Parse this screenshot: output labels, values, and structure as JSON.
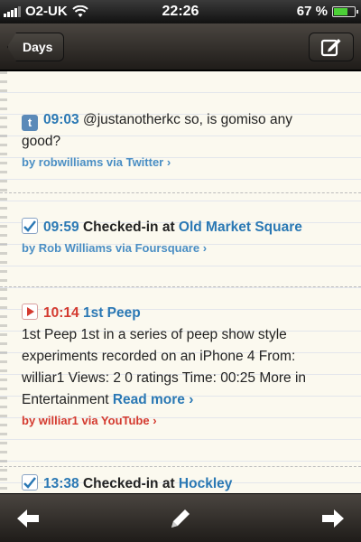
{
  "status_bar": {
    "carrier": "O2-UK",
    "time": "22:26",
    "battery_percent": "67 %",
    "battery_level": 0.67
  },
  "nav": {
    "back_label": "Days",
    "compose_icon": "compose-icon"
  },
  "entries": [
    {
      "service": "twitter",
      "time": "09:03",
      "line1": "@justanotherkc so, is gomiso any",
      "line2": "good?",
      "meta": "by robwilliams via Twitter ›"
    },
    {
      "service": "foursquare",
      "time": "09:59",
      "action": "Checked-in at",
      "place": "Old Market Square",
      "meta": "by Rob Williams via Foursquare ›"
    },
    {
      "service": "youtube",
      "time": "10:14",
      "title": "1st Peep",
      "body_lines": [
        "1st Peep 1st in a series of peep show style",
        "experiments recorded on an iPhone 4 From:",
        "williar1 Views: 2 0 ratings Time: 00:25 More in"
      ],
      "body_last": "Entertainment",
      "read_more": "Read more ›",
      "meta": "by williar1 via YouTube ›"
    },
    {
      "service": "foursquare",
      "time": "13:38",
      "action": "Checked-in at",
      "place": "Hockley"
    }
  ],
  "toolbar": {
    "prev_icon": "arrow-left-icon",
    "edit_icon": "pencil-icon",
    "next_icon": "arrow-right-icon"
  },
  "colors": {
    "link_blue": "#2a78b4",
    "youtube_red": "#d43a2f",
    "paper": "#fbf9ef"
  }
}
